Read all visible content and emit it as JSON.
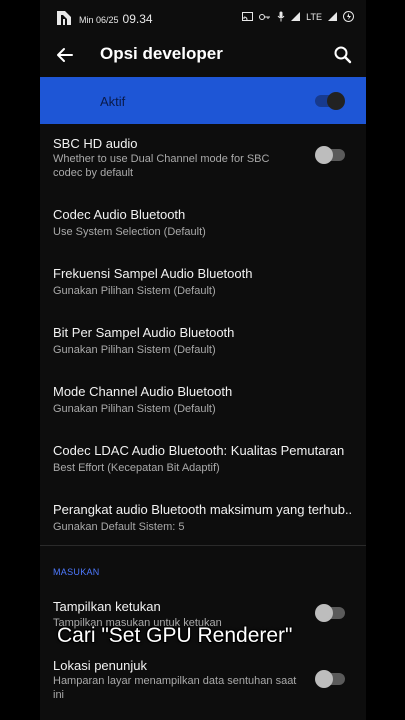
{
  "status_bar": {
    "date": "Min 06/25",
    "time": "09.34",
    "network": "LTE"
  },
  "app_bar": {
    "title": "Opsi developer"
  },
  "master_switch": {
    "label": "Aktif",
    "on": true
  },
  "items": [
    {
      "title": "SBC HD audio",
      "subtitle": "Whether to use Dual Channel mode for SBC codec by default",
      "toggle": false
    },
    {
      "title": "Codec Audio Bluetooth",
      "subtitle": "Use System Selection (Default)"
    },
    {
      "title": "Frekuensi Sampel Audio Bluetooth",
      "subtitle": "Gunakan Pilihan Sistem (Default)"
    },
    {
      "title": "Bit Per Sampel Audio Bluetooth",
      "subtitle": "Gunakan Pilihan Sistem (Default)"
    },
    {
      "title": "Mode Channel Audio Bluetooth",
      "subtitle": "Gunakan Pilihan Sistem (Default)"
    },
    {
      "title": "Codec LDAC Audio Bluetooth: Kualitas Pemutaran",
      "subtitle": "Best Effort (Kecepatan Bit Adaptif)"
    },
    {
      "title": "Perangkat audio Bluetooth maksimum yang terhub..",
      "subtitle": "Gunakan Default Sistem: 5"
    }
  ],
  "section_header": "MASUKAN",
  "input_items": [
    {
      "title": "Tampilkan ketukan",
      "subtitle": "Tampilkan masukan untuk ketukan",
      "toggle": false
    },
    {
      "title": "Lokasi penunjuk",
      "subtitle": "Hamparan layar menampilkan data sentuhan saat ini",
      "toggle": false
    }
  ],
  "overlay_caption": "Cari \"Set GPU Renderer\"",
  "colors": {
    "accent": "#1e56d6",
    "section": "#4d79ff",
    "background": "#0d0d0d"
  }
}
